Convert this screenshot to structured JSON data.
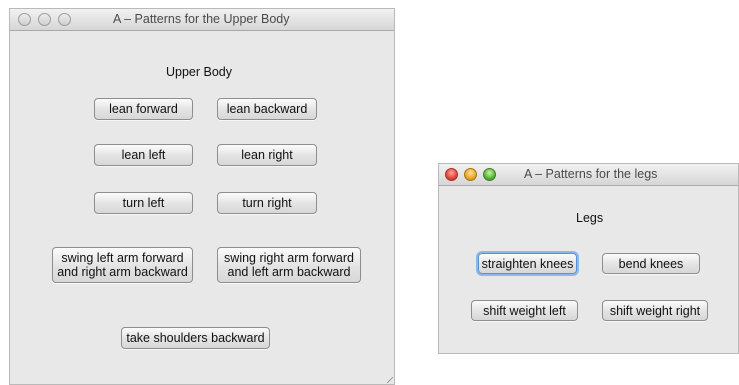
{
  "upper_window": {
    "title": "A – Patterns for the Upper Body",
    "heading": "Upper Body",
    "buttons": {
      "lean_forward": "lean forward",
      "lean_backward": "lean backward",
      "lean_left": "lean left",
      "lean_right": "lean right",
      "turn_left": "turn left",
      "turn_right": "turn right",
      "swing_left_arm": "swing left arm forward\nand right arm backward",
      "swing_right_arm": "swing right arm forward\nand left arm backward",
      "take_shoulders_backward": "take shoulders backward"
    },
    "state": "inactive"
  },
  "legs_window": {
    "title": "A – Patterns for the legs",
    "heading": "Legs",
    "buttons": {
      "straighten_knees": "straighten knees",
      "bend_knees": "bend knees",
      "shift_weight_left": "shift weight left",
      "shift_weight_right": "shift weight right"
    },
    "focused_button": "straighten knees",
    "state": "active"
  },
  "icons": {
    "close": "close-icon",
    "minimize": "minimize-icon",
    "zoom": "zoom-icon",
    "resize": "resize-grip-icon"
  },
  "colors": {
    "window_bg": "#e8e8e8",
    "focus_ring": "#8fb8ea",
    "close_red": "#e0453a",
    "minimize_yellow": "#e9a52b",
    "zoom_green": "#58b43a"
  }
}
